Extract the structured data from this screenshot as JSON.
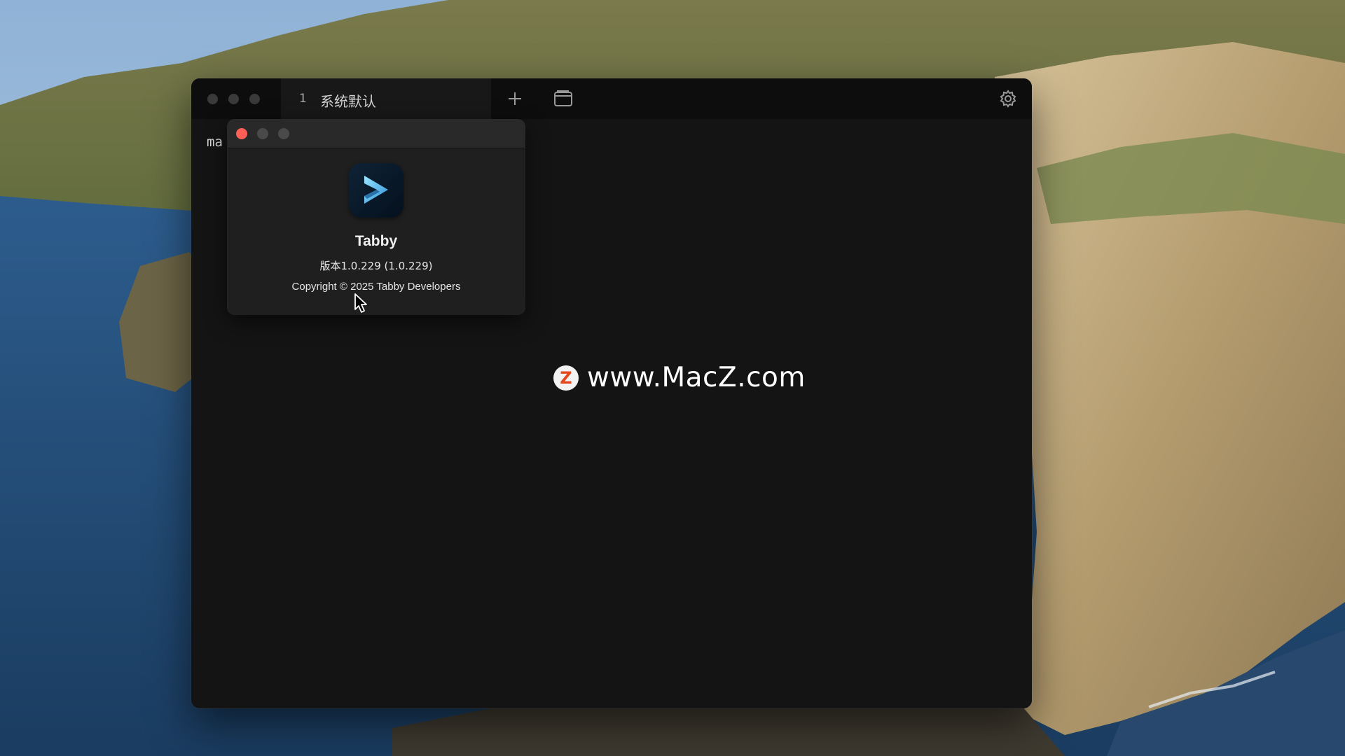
{
  "terminal": {
    "tab_index": "1",
    "tab_title": "系统默认",
    "new_tab_icon": "plus-icon",
    "split_icon": "window-icon",
    "settings_icon": "gear-icon",
    "visible_text": "ma"
  },
  "about": {
    "app_name": "Tabby",
    "version": "版本1.0.229 (1.0.229)",
    "copyright": "Copyright © 2025 Tabby Developers",
    "icon": "tabby-app-icon"
  },
  "watermark": {
    "logo_letter": "Z",
    "text": "www.MacZ.com"
  },
  "colors": {
    "close": "#ff5f57",
    "inactive": "#4a4a4a",
    "terminal_bg": "#141414",
    "titlebar_bg": "#0d0d0d",
    "tab_bg": "#181818",
    "watermark_logo": "#e4461d"
  }
}
